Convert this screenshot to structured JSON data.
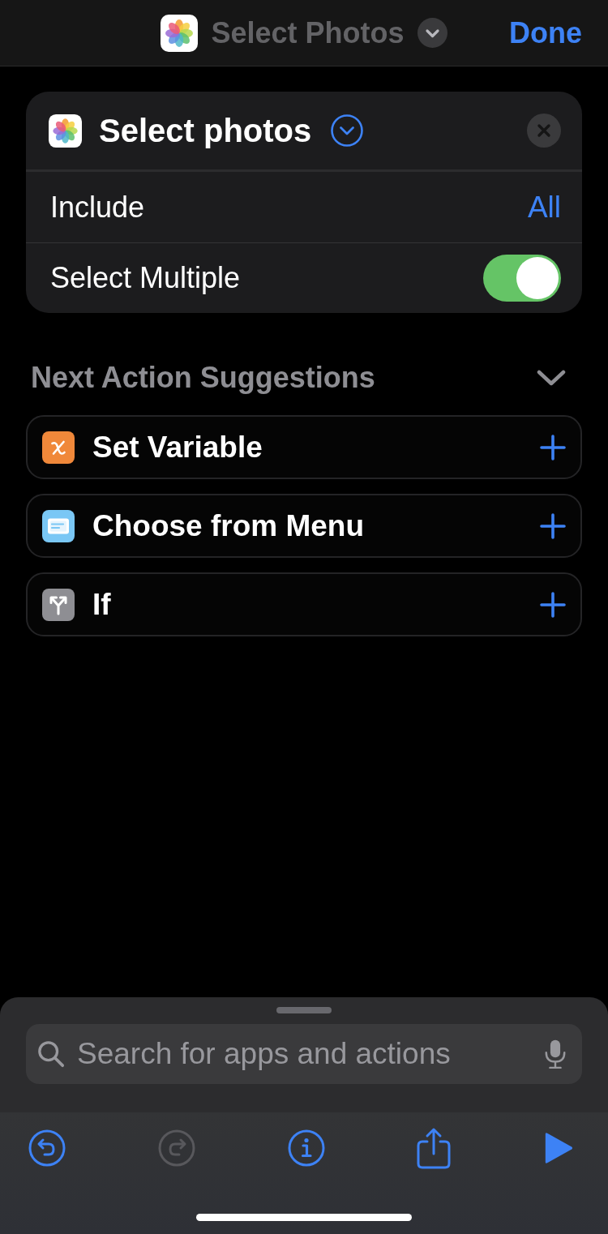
{
  "nav_bar": {
    "title": "Select Photos",
    "done": "Done"
  },
  "action_card": {
    "title": "Select photos",
    "rows": [
      {
        "kind": "value",
        "label": "Include",
        "value": "All"
      },
      {
        "kind": "toggle",
        "label": "Select Multiple",
        "on": true
      }
    ]
  },
  "suggestions": {
    "title": "Next Action Suggestions",
    "items": [
      {
        "kind": "variable",
        "label": "Set Variable",
        "color": "#f0883a"
      },
      {
        "kind": "menu",
        "label": "Choose from Menu",
        "color": "#7ac7f5"
      },
      {
        "kind": "branch",
        "label": "If",
        "color": "#8e8e93"
      }
    ]
  },
  "search": {
    "placeholder": "Search for apps and actions"
  },
  "toolbar": [
    {
      "kind": "undo",
      "disabled": false
    },
    {
      "kind": "redo",
      "disabled": true
    },
    {
      "kind": "info",
      "disabled": false
    },
    {
      "kind": "share",
      "disabled": false
    },
    {
      "kind": "run",
      "disabled": false
    }
  ]
}
